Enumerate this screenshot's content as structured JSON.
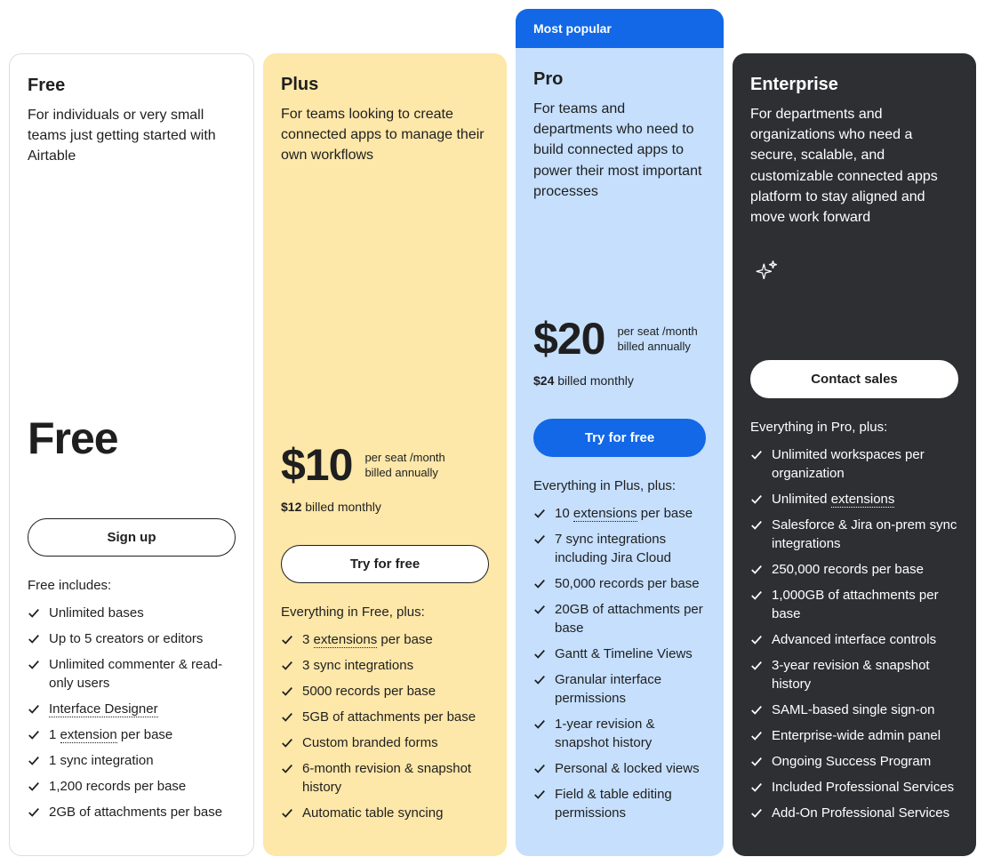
{
  "popular_badge": "Most popular",
  "plans": {
    "free": {
      "name": "Free",
      "desc": "For individuals or very small teams just getting started with Airtable",
      "price_big": "Free",
      "cta": "Sign up",
      "includes_heading": "Free includes:",
      "features": [
        "Unlimited bases",
        "Up to 5 creators or editors",
        "Unlimited commenter & read-only users",
        "Interface Designer",
        "1 extension per base",
        "1 sync integration",
        "1,200 records per base",
        "2GB of attachments per base"
      ]
    },
    "plus": {
      "name": "Plus",
      "desc": "For teams looking to create connected apps to manage their own workflows",
      "price_big": "$10",
      "price_sub1": "per seat /month",
      "price_sub2": "billed annually",
      "price_alt_bold": "$12",
      "price_alt_rest": " billed monthly",
      "cta": "Try for free",
      "includes_heading": "Everything in Free, plus:",
      "features": [
        "3 extensions per base",
        "3 sync integrations",
        "5000 records per base",
        "5GB of attachments per base",
        "Custom branded forms",
        "6-month revision & snapshot history",
        "Automatic table syncing"
      ]
    },
    "pro": {
      "name": "Pro",
      "desc": "For teams and departments who need to build connected apps to power their most important processes",
      "price_big": "$20",
      "price_sub1": "per seat /month",
      "price_sub2": "billed annually",
      "price_alt_bold": "$24",
      "price_alt_rest": " billed monthly",
      "cta": "Try for free",
      "includes_heading": "Everything in Plus, plus:",
      "features": [
        "10 extensions per base",
        "7 sync integrations including Jira Cloud",
        "50,000 records per base",
        "20GB of attachments per base",
        "Gantt & Timeline Views",
        "Granular interface permissions",
        "1-year revision & snapshot history",
        "Personal & locked views",
        "Field & table editing permissions"
      ]
    },
    "ent": {
      "name": "Enterprise",
      "desc": "For departments and organizations who need a secure, scalable, and customizable connected apps platform to stay aligned and move work forward",
      "cta": "Contact sales",
      "includes_heading": "Everything in Pro, plus:",
      "features": [
        "Unlimited workspaces per organization",
        "Unlimited extensions",
        "Salesforce & Jira on-prem sync integrations",
        "250,000 records per base",
        "1,000GB of attachments per base",
        "Advanced interface controls",
        "3-year revision & snapshot history",
        "SAML-based single sign-on",
        "Enterprise-wide admin panel",
        "Ongoing Success Program",
        "Included Professional Services",
        "Add-On Professional Services"
      ]
    }
  },
  "dotted_terms": [
    "Interface Designer",
    "extension",
    "extensions"
  ]
}
